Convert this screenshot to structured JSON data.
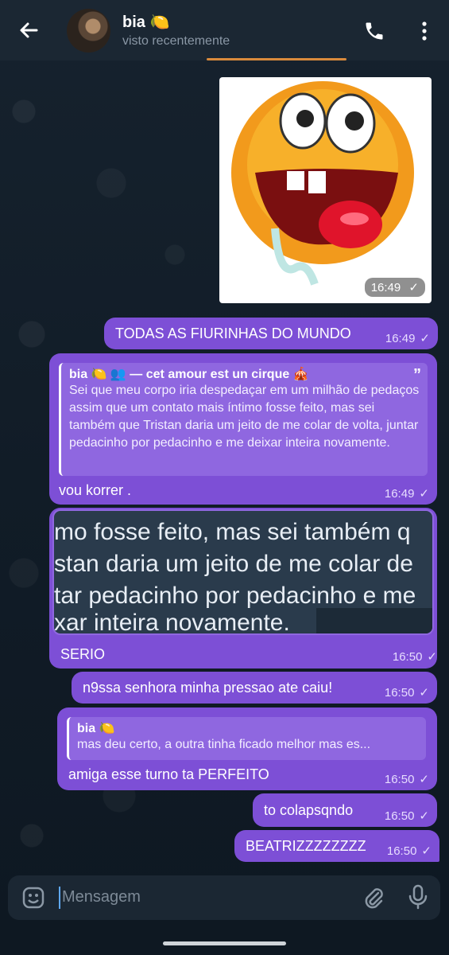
{
  "header": {
    "title": "bia 🍋",
    "status": "visto recentemente"
  },
  "messages": {
    "image_time": "16:49",
    "m1_text": "TODAS AS FIURINHAS DO MUNDO",
    "m1_time": "16:49",
    "m2_reply_name": "bia 🍋 👥 — cet amour est un cirque 🎪",
    "m2_reply_text": "Sei que meu corpo iria despedaçar em um milhão de pedaços assim que um contato mais íntimo fosse feito, mas sei também que Tristan daria um jeito de me colar de volta, juntar pedacinho por pedacinho e me deixar inteira novamente.",
    "m2_text": "vou korrer .",
    "m2_time": "16:49",
    "m3_ss_line1": "mo fosse feito, mas sei também q",
    "m3_ss_line2": "stan daria um jeito de me colar de",
    "m3_ss_line3": "tar pedacinho por pedacinho e me",
    "m3_ss_line4": "xar inteira novamente.",
    "m3_text": "SERIO",
    "m3_time": "16:50",
    "m4_text": "n9ssa senhora minha pressao ate caiu!",
    "m4_time": "16:50",
    "m5_reply_name": "bia 🍋",
    "m5_reply_text": "mas deu certo, a outra tinha ficado melhor mas es...",
    "m5_text": "amiga esse turno ta PERFEITO",
    "m5_time": "16:50",
    "m6_text": "to colapsqndo",
    "m6_time": "16:50",
    "m7_text": "BEATRIZZZZZZZZ",
    "m7_time": "16:50",
    "check": "✓"
  },
  "input": {
    "placeholder": "Mensagem"
  },
  "icons": [
    "back-arrow-icon",
    "phone-icon",
    "more-vertical-icon",
    "emoji-icon",
    "attach-icon",
    "microphone-icon",
    "check-icon"
  ]
}
